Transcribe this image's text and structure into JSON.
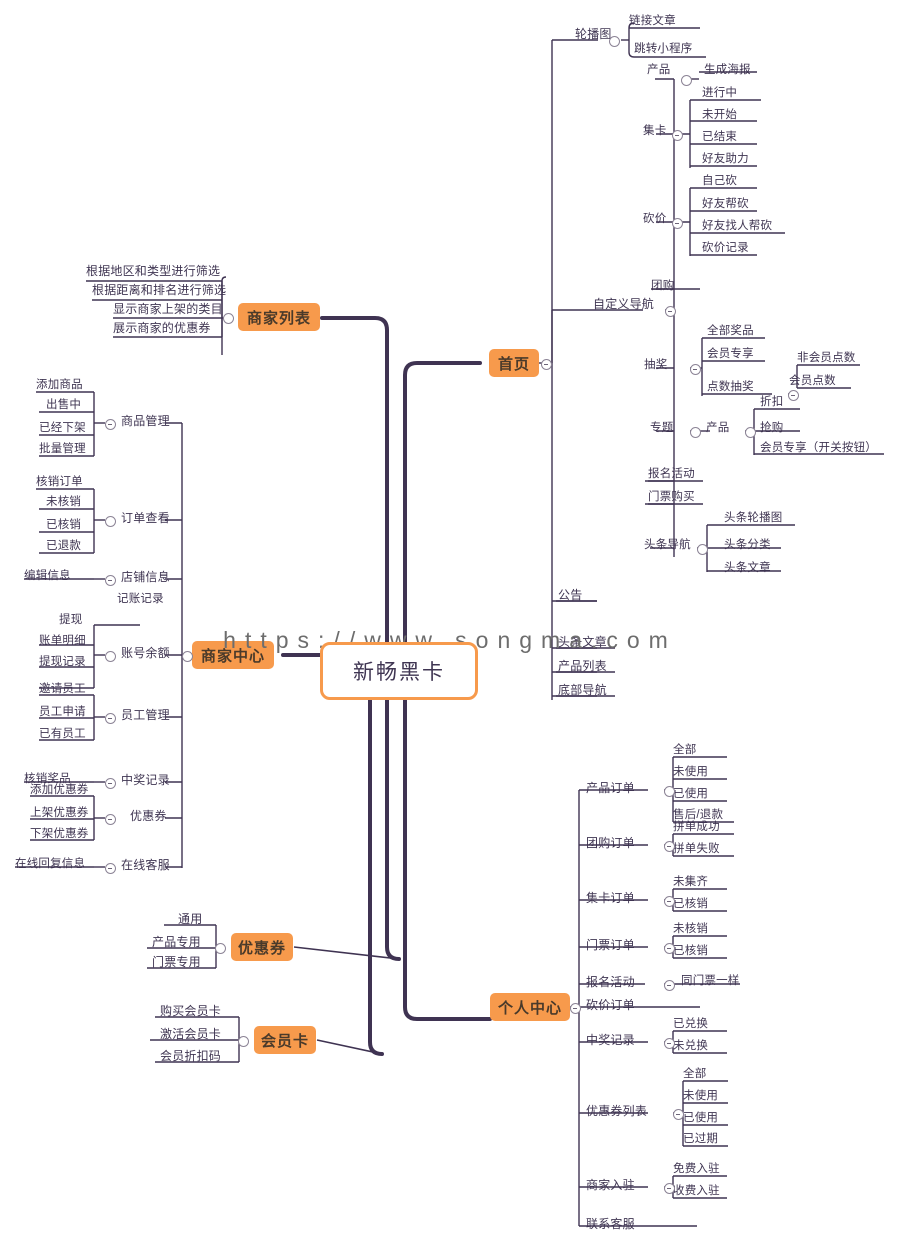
{
  "watermark": "https://www.songma.com",
  "colors": {
    "branch_node_bg": "#f79a4c",
    "root_border": "#f79a4c",
    "trunk_line": "#3f3352",
    "thin_line": "#6d6578",
    "text": "#3f3552",
    "watermark_text": "#6d6d6d",
    "background": "#ffffff"
  },
  "root": {
    "label": "新畅黑卡"
  },
  "branches": {
    "shangjia_liebiao": {
      "label": "商家列表",
      "children": [
        {
          "label": "根据地区和类型进行筛选"
        },
        {
          "label": "根据距离和排名进行筛选"
        },
        {
          "label": "显示商家上架的类目"
        },
        {
          "label": "展示商家的优惠券"
        }
      ]
    },
    "shouye": {
      "label": "首页",
      "children": [
        {
          "label": "轮播图",
          "children": [
            {
              "label": "链接文章"
            },
            {
              "label": "跳转小程序"
            }
          ]
        },
        {
          "label": "自定义导航",
          "children": [
            {
              "label": "产品",
              "children": [
                {
                  "label": "生成海报"
                }
              ]
            },
            {
              "label": "集卡",
              "children": [
                {
                  "label": "进行中"
                },
                {
                  "label": "未开始"
                },
                {
                  "label": "已结束"
                },
                {
                  "label": "好友助力"
                }
              ]
            },
            {
              "label": "砍价",
              "children": [
                {
                  "label": "自己砍"
                },
                {
                  "label": "好友帮砍"
                },
                {
                  "label": "好友找人帮砍"
                },
                {
                  "label": "砍价记录"
                }
              ]
            },
            {
              "label": "团购"
            },
            {
              "label": "抽奖",
              "children": [
                {
                  "label": "全部奖品"
                },
                {
                  "label": "会员专享"
                },
                {
                  "label": "点数抽奖",
                  "children": [
                    {
                      "label": "非会员点数"
                    },
                    {
                      "label": "会员点数"
                    }
                  ]
                }
              ]
            },
            {
              "label": "专题",
              "children": [
                {
                  "label": "产品",
                  "children": [
                    {
                      "label": "折扣"
                    },
                    {
                      "label": "抢购"
                    },
                    {
                      "label": "会员专享（开关按钮）"
                    }
                  ]
                }
              ]
            },
            {
              "label": "报名活动"
            },
            {
              "label": "门票购买"
            },
            {
              "label": "头条导航",
              "children": [
                {
                  "label": "头条轮播图"
                },
                {
                  "label": "头条分类"
                },
                {
                  "label": "头条文章"
                }
              ]
            }
          ]
        },
        {
          "label": "公告"
        },
        {
          "label": "头条文章"
        },
        {
          "label": "产品列表"
        },
        {
          "label": "底部导航"
        }
      ]
    },
    "shangjia_zhongxin": {
      "label": "商家中心",
      "children": [
        {
          "label": "商品管理",
          "children": [
            {
              "label": "添加商品"
            },
            {
              "label": "出售中"
            },
            {
              "label": "已经下架"
            },
            {
              "label": "批量管理"
            }
          ]
        },
        {
          "label": "订单查看",
          "children": [
            {
              "label": "核销订单"
            },
            {
              "label": "未核销"
            },
            {
              "label": "已核销"
            },
            {
              "label": "已退款"
            }
          ]
        },
        {
          "label": "店铺信息",
          "children": [
            {
              "label": "编辑信息"
            }
          ]
        },
        {
          "label": "账号余额",
          "children": [
            {
              "label": "记账记录"
            },
            {
              "label": "提现"
            },
            {
              "label": "账单明细"
            },
            {
              "label": "提现记录"
            }
          ]
        },
        {
          "label": "员工管理",
          "children": [
            {
              "label": "邀请员工"
            },
            {
              "label": "员工申请"
            },
            {
              "label": "已有员工"
            }
          ]
        },
        {
          "label": "中奖记录",
          "children": [
            {
              "label": "核销奖品"
            }
          ]
        },
        {
          "label": "优惠券",
          "children": [
            {
              "label": "添加优惠券"
            },
            {
              "label": "上架优惠券"
            },
            {
              "label": "下架优惠券"
            }
          ]
        },
        {
          "label": "在线客服",
          "children": [
            {
              "label": "在线回复信息"
            }
          ]
        }
      ]
    },
    "youhuiquan": {
      "label": "优惠券",
      "children": [
        {
          "label": "通用"
        },
        {
          "label": "产品专用"
        },
        {
          "label": "门票专用"
        }
      ]
    },
    "huiyuanka": {
      "label": "会员卡",
      "children": [
        {
          "label": "购买会员卡"
        },
        {
          "label": "激活会员卡"
        },
        {
          "label": "会员折扣码"
        }
      ]
    },
    "geren_zhongxin": {
      "label": "个人中心",
      "children": [
        {
          "label": "产品订单",
          "children": [
            {
              "label": "全部"
            },
            {
              "label": "未使用"
            },
            {
              "label": "已使用"
            },
            {
              "label": "售后/退款"
            }
          ]
        },
        {
          "label": "团购订单",
          "children": [
            {
              "label": "拼单成功"
            },
            {
              "label": "拼单失败"
            }
          ]
        },
        {
          "label": "集卡订单",
          "children": [
            {
              "label": "未集齐"
            },
            {
              "label": "已核销"
            }
          ]
        },
        {
          "label": "门票订单",
          "children": [
            {
              "label": "未核销"
            },
            {
              "label": "已核销"
            }
          ]
        },
        {
          "label": "报名活动",
          "children": [
            {
              "label": "同门票一样"
            }
          ]
        },
        {
          "label": "砍价订单"
        },
        {
          "label": "中奖记录",
          "children": [
            {
              "label": "已兑换"
            },
            {
              "label": "未兑换"
            }
          ]
        },
        {
          "label": "优惠券列表",
          "children": [
            {
              "label": "全部"
            },
            {
              "label": "未使用"
            },
            {
              "label": "已使用"
            },
            {
              "label": "已过期"
            }
          ]
        },
        {
          "label": "商家入驻",
          "children": [
            {
              "label": "免费入驻"
            },
            {
              "label": "收费入驻"
            }
          ]
        },
        {
          "label": "联系客服"
        }
      ]
    }
  }
}
